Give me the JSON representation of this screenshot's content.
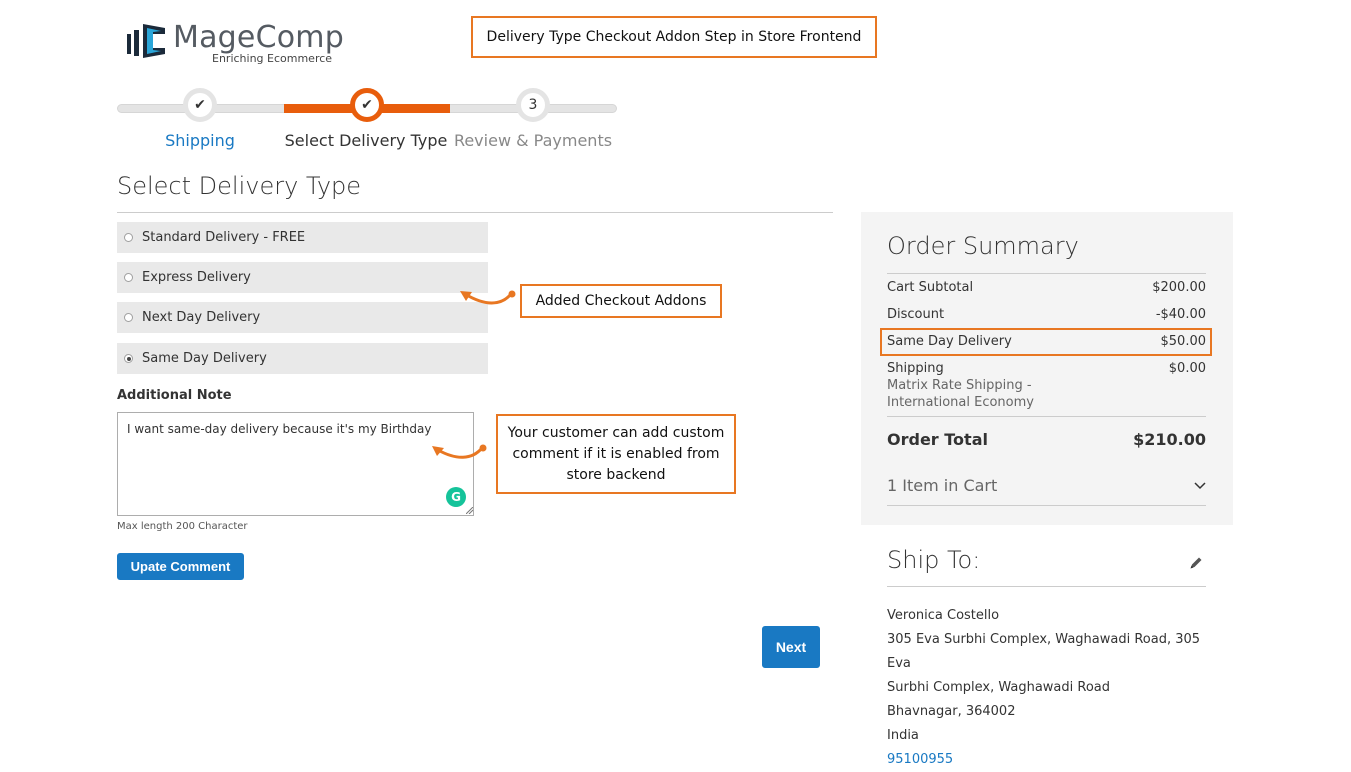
{
  "logo": {
    "name": "MageComp",
    "tagline": "Enriching Ecommerce"
  },
  "top_callout": "Delivery Type Checkout Addon Step in Store Frontend",
  "progress": {
    "steps": [
      {
        "label": "Shipping",
        "marker": "✔",
        "state": "complete"
      },
      {
        "label": "Select Delivery Type",
        "marker": "✔",
        "state": "active"
      },
      {
        "label": "Review & Payments",
        "marker": "3",
        "state": "pending"
      }
    ]
  },
  "section_title": "Select Delivery Type",
  "delivery_options": [
    {
      "label": "Standard Delivery - FREE",
      "checked": false
    },
    {
      "label": "Express Delivery",
      "checked": false
    },
    {
      "label": "Next Day Delivery",
      "checked": false
    },
    {
      "label": "Same Day Delivery",
      "checked": true
    }
  ],
  "note": {
    "label": "Additional Note",
    "value": "I want same-day delivery because it's my Birthday",
    "max_length_hint": "Max length 200 Character"
  },
  "buttons": {
    "update_comment": "Upate Comment",
    "next": "Next"
  },
  "callouts": {
    "addons": "Added Checkout Addons",
    "comment": "Your customer can add custom comment if it is enabled from store backend"
  },
  "order_summary": {
    "title": "Order Summary",
    "rows": [
      {
        "label": "Cart Subtotal",
        "value": "$200.00"
      },
      {
        "label": "Discount",
        "value": "-$40.00"
      },
      {
        "label": "Same Day Delivery",
        "value": "$50.00"
      },
      {
        "label": "Shipping",
        "value": "$0.00"
      }
    ],
    "shipping_method": "Matrix Rate Shipping - International Economy",
    "total_label": "Order Total",
    "total_value": "$210.00",
    "items_in_cart": "1 Item in Cart"
  },
  "ship_to": {
    "title": "Ship To:",
    "lines": [
      "Veronica Costello",
      "305 Eva Surbhi Complex, Waghawadi Road, 305 Eva",
      "Surbhi Complex, Waghawadi Road",
      "Bhavnagar, 364002",
      "India"
    ],
    "phone": "95100955"
  },
  "colors": {
    "accent": "#e85d0c",
    "callout_border": "#e87722",
    "primary_button": "#1979c3",
    "step_label_link": "#1979c3"
  }
}
